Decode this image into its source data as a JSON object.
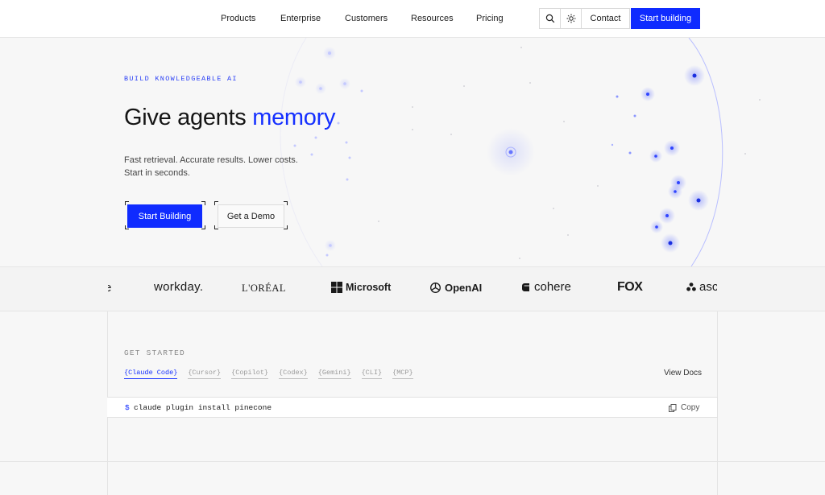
{
  "nav": {
    "items": [
      {
        "label": "Products"
      },
      {
        "label": "Enterprise"
      },
      {
        "label": "Customers"
      },
      {
        "label": "Resources"
      },
      {
        "label": "Pricing"
      }
    ],
    "search_icon": "search-icon",
    "theme_icon": "sun-icon",
    "contact_label": "Contact",
    "cta_label": "Start building"
  },
  "hero": {
    "eyebrow": "BUILD KNOWLEDGEABLE AI",
    "title_prefix": "Give agents ",
    "title_accent": "memory",
    "subtitle": "Fast retrieval. Accurate results. Lower costs. Start in seconds.",
    "primary_label": "Start Building",
    "secondary_label": "Get a Demo"
  },
  "logos": [
    {
      "name": "workday."
    },
    {
      "name": "L'ORÉAL"
    },
    {
      "name": "Microsoft"
    },
    {
      "name": "OpenAI"
    },
    {
      "name": "cohere"
    },
    {
      "name": "FOX"
    },
    {
      "name": "asc"
    }
  ],
  "get_started": {
    "label": "GET STARTED",
    "tabs": [
      {
        "label": "{Claude Code}",
        "active": true
      },
      {
        "label": "{Cursor}"
      },
      {
        "label": "{Copilot}"
      },
      {
        "label": "{Codex}"
      },
      {
        "label": "{Gemini}"
      },
      {
        "label": "{CLI}"
      },
      {
        "label": "{MCP}"
      }
    ],
    "view_docs": "View Docs",
    "prompt": "$",
    "command": "claude plugin install pinecone",
    "copy_label": "Copy"
  },
  "colors": {
    "accent": "#0f2bff",
    "background": "#f7f7f7"
  }
}
